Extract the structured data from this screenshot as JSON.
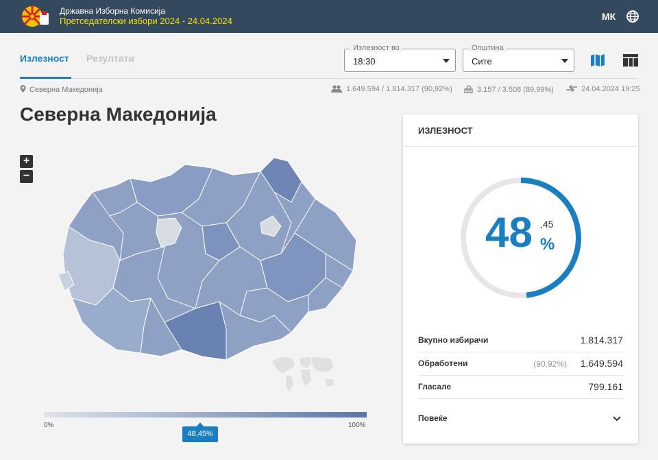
{
  "header": {
    "org_name": "Државна Изборна Комисија",
    "election_name": "Претседателски избори 2024 - 24.04.2024",
    "language": "МК",
    "logo_icon": "dik-logo",
    "globe_icon": "globe-icon"
  },
  "tabs": [
    {
      "label": "Излезност",
      "active": true
    },
    {
      "label": "Резултати",
      "active": false
    }
  ],
  "filters": {
    "time": {
      "legend": "Излезност во",
      "value": "18:30"
    },
    "municipality": {
      "legend": "Општина",
      "value": "Сите"
    }
  },
  "view_toggle": {
    "map_icon": "map-icon",
    "table_icon": "table-icon"
  },
  "breadcrumb": "Северна Македонија",
  "stats": {
    "voters": "1.649.594 / 1.814.317 (90,92%)",
    "stations": "3.157 / 3.508 (89,99%)",
    "updated": "24.04.2024 19:25"
  },
  "page_title": "Северна Македонија",
  "zoom": {
    "in": "+",
    "out": "−"
  },
  "legend": {
    "min": "0%",
    "max": "100%",
    "marker": "48,45%",
    "marker_value_pct": 48.45
  },
  "card": {
    "title": "ИЗЛЕЗНОСТ",
    "gauge": {
      "integer": "48",
      "decimal": ",45",
      "unit": "%",
      "fraction": 0.4845
    },
    "rows": [
      {
        "label": "Вкупно избирачи",
        "pct": "",
        "value": "1.814.317"
      },
      {
        "label": "Обработени",
        "pct": "(90,92%)",
        "value": "1.649.594"
      },
      {
        "label": "Гласале",
        "pct": "",
        "value": "799.161"
      }
    ],
    "more_label": "Повеќе"
  },
  "colors": {
    "header_bg": "#34495e",
    "accent": "#1a7fc1",
    "election_title": "#f5e100",
    "map_low": "#dfe3ea",
    "map_high": "#5a76a6"
  }
}
